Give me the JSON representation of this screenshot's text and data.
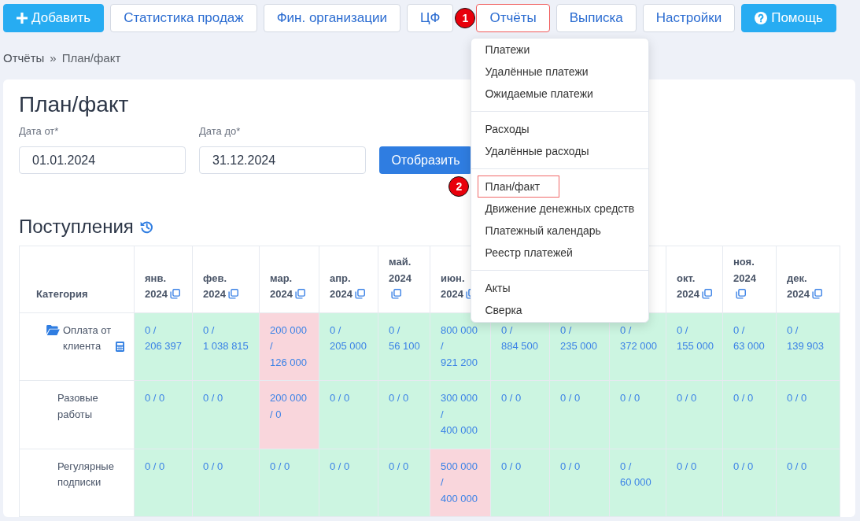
{
  "nav": [
    {
      "label": "Добавить",
      "kind": "add",
      "highlighted": false
    },
    {
      "label": "Статистика продаж",
      "kind": "plain",
      "highlighted": false
    },
    {
      "label": "Фин. организации",
      "kind": "plain",
      "highlighted": false
    },
    {
      "label": "ЦФ",
      "kind": "plain",
      "highlighted": false
    },
    {
      "label": "Отчёты",
      "kind": "plain",
      "highlighted": true,
      "step": "1",
      "expanded": true,
      "menu": [
        [
          {
            "label": "Платежи",
            "highlighted": false
          },
          {
            "label": "Удалённые платежи",
            "highlighted": false
          },
          {
            "label": "Ожидаемые платежи",
            "highlighted": false
          }
        ],
        [
          {
            "label": "Расходы",
            "highlighted": false
          },
          {
            "label": "Удалённые расходы",
            "highlighted": false
          }
        ],
        [
          {
            "label": "План/факт",
            "highlighted": true,
            "step": "2"
          },
          {
            "label": "Движение денежных средств",
            "highlighted": false
          },
          {
            "label": "Платежный календарь",
            "highlighted": false
          },
          {
            "label": "Реестр платежей",
            "highlighted": false
          }
        ],
        [
          {
            "label": "Акты",
            "highlighted": false
          },
          {
            "label": "Сверка",
            "highlighted": false
          }
        ]
      ]
    },
    {
      "label": "Выписка",
      "kind": "plain",
      "highlighted": false
    },
    {
      "label": "Настройки",
      "kind": "plain",
      "highlighted": false
    },
    {
      "label": "Помощь",
      "kind": "help",
      "highlighted": false
    }
  ],
  "breadcrumb": {
    "items": [
      "Отчёты",
      "План/факт"
    ],
    "separator": "»"
  },
  "page": {
    "title": "План/факт",
    "filters": [
      {
        "label": "Дата от*",
        "value": "01.01.2024"
      },
      {
        "label": "Дата до*",
        "value": "31.12.2024"
      }
    ],
    "submit": "Отобразить"
  },
  "section": {
    "title": "Поступления",
    "table": {
      "category_header": "Категория",
      "columns": [
        {
          "label": "янв. 2024"
        },
        {
          "label": "фев. 2024"
        },
        {
          "label": "мар. 2024"
        },
        {
          "label": "апр. 2024"
        },
        {
          "label": "май. 2024"
        },
        {
          "label": "июн. 2024"
        },
        {},
        {},
        {},
        {
          "label": "окт. 2024"
        },
        {
          "label": "ноя. 2024"
        },
        {
          "label": "дек. 2024"
        }
      ],
      "rows": [
        {
          "category": "Оплата от клиента",
          "expanded": true,
          "cells": [
            {
              "value": "0 / 206 397",
              "color": "#ccf5e1"
            },
            {
              "value": "0 / 1 038 815",
              "color": "#ccf5e1"
            },
            {
              "value": "200 000 / 126 000",
              "color": "#f9d6dc"
            },
            {
              "value": "0 / 205 000",
              "color": "#ccf5e1"
            },
            {
              "value": "0 / 56 100",
              "color": "#ccf5e1"
            },
            {
              "value": "800 000 / 921 200",
              "color": "#ccf5e1"
            },
            {
              "value": "0 / 884 500",
              "color": "#ccf5e1"
            },
            {
              "value": "0 / 235 000",
              "color": "#ccf5e1"
            },
            {
              "value": "0 / 372 000",
              "color": "#ccf5e1"
            },
            {
              "value": "0 / 155 000",
              "color": "#ccf5e1"
            },
            {
              "value": "0 / 63 000",
              "color": "#ccf5e1"
            },
            {
              "value": "0 / 139 903",
              "color": "#ccf5e1"
            }
          ],
          "children": [
            {
              "category": "Разовые работы",
              "cells": [
                {
                  "value": "0 / 0",
                  "color": "#ccf5e1"
                },
                {
                  "value": "0 / 0",
                  "color": "#ccf5e1"
                },
                {
                  "value": "200 000 / 0",
                  "color": "#f9d6dc"
                },
                {
                  "value": "0 / 0",
                  "color": "#ccf5e1"
                },
                {
                  "value": "0 / 0",
                  "color": "#ccf5e1"
                },
                {
                  "value": "300 000 / 400 000",
                  "color": "#ccf5e1"
                },
                {
                  "value": "0 / 0",
                  "color": "#ccf5e1"
                },
                {
                  "value": "0 / 0",
                  "color": "#ccf5e1"
                },
                {
                  "value": "0 / 0",
                  "color": "#ccf5e1"
                },
                {
                  "value": "0 / 0",
                  "color": "#ccf5e1"
                },
                {
                  "value": "0 / 0",
                  "color": "#ccf5e1"
                },
                {
                  "value": "0 / 0",
                  "color": "#ccf5e1"
                }
              ]
            },
            {
              "category": "Регулярные подписки",
              "cells": [
                {
                  "value": "0 / 0",
                  "color": "#ccf5e1"
                },
                {
                  "value": "0 / 0",
                  "color": "#ccf5e1"
                },
                {
                  "value": "0 / 0",
                  "color": "#ccf5e1"
                },
                {
                  "value": "0 / 0",
                  "color": "#ccf5e1"
                },
                {
                  "value": "0 / 0",
                  "color": "#ccf5e1"
                },
                {
                  "value": "500 000 / 400 000",
                  "color": "#f9d6dc"
                },
                {
                  "value": "0 / 0",
                  "color": "#ccf5e1"
                },
                {
                  "value": "0 / 0",
                  "color": "#ccf5e1"
                },
                {
                  "value": "0 / 60 000",
                  "color": "#ccf5e1"
                },
                {
                  "value": "0 / 0",
                  "color": "#ccf5e1"
                },
                {
                  "value": "0 / 0",
                  "color": "#ccf5e1"
                },
                {
                  "value": "0 / 0",
                  "color": "#ccf5e1"
                }
              ]
            }
          ]
        }
      ]
    }
  }
}
